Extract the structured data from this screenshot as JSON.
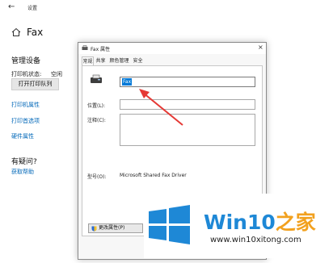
{
  "window": {
    "title": "设置"
  },
  "page": {
    "title": "Fax"
  },
  "manage": {
    "section_title": "管理设备",
    "status_label": "打印机状态:",
    "status_value": "空闲",
    "open_queue_label": "打开打印队列"
  },
  "links": [
    "打印机属性",
    "打印首选项",
    "硬件属性"
  ],
  "help": {
    "title": "有疑问?",
    "link": "获取帮助"
  },
  "dialog": {
    "title": "Fax 属性",
    "close": "×",
    "tabs": [
      "常规",
      "共享",
      "颜色管理",
      "安全"
    ],
    "active_tab": "常规",
    "name_value": "Fax",
    "location_label": "位置(L):",
    "location_value": "",
    "comment_label": "注释(C):",
    "comment_value": "",
    "model_label": "型号(O):",
    "model_value": "Microsoft Shared Fax Driver",
    "change_props_label": "更改属性(P)"
  },
  "watermark": {
    "brand_main": "Win10",
    "brand_suffix": "之家",
    "url": "www.win10xitong.com",
    "logo_color": "#1e88d6",
    "suffix_color": "#f2a11f"
  },
  "colors": {
    "link": "#0067b8",
    "selection": "#0078d7",
    "annotation_arrow": "#e53935"
  }
}
